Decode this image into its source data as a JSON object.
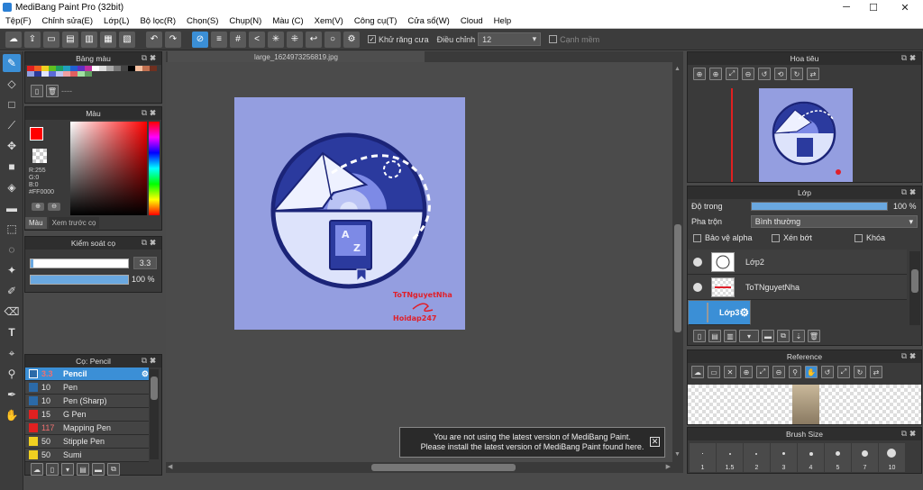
{
  "window": {
    "title": "MediBang Paint Pro (32bit)",
    "minimize": "─",
    "maximize": "☐",
    "close": "✕"
  },
  "menu": [
    "Tệp(F)",
    "Chỉnh sửa(E)",
    "Lớp(L)",
    "Bộ lọc(R)",
    "Chọn(S)",
    "Chụp(N)",
    "Màu (C)",
    "Xem(V)",
    "Công cụ(T)",
    "Cửa sổ(W)",
    "Cloud",
    "Help"
  ],
  "toolbar": {
    "antialias_label": "Khử răng cưa",
    "correction_label": "Điều chỉnh",
    "correction_value": "12",
    "snap_label": "Cạnh mềm"
  },
  "document": {
    "tab_name": "large_1624973256819.jpg"
  },
  "canvas": {
    "watermark_name": "ToTNguyetNha",
    "watermark_site": "Hoidap247"
  },
  "palette": {
    "title": "Bảng màu",
    "more": "----"
  },
  "color": {
    "title": "Màu",
    "readout": [
      "R:255",
      "G:0",
      "B:0",
      "#FF0000"
    ],
    "tab_color": "Màu",
    "tab_preview": "Xem trước cọ",
    "primary": "#ff0000"
  },
  "brush_control": {
    "title": "Kiểm soát cọ",
    "size": "3.3",
    "opacity": "100 %"
  },
  "brushes": {
    "title": "Cọ: Pencil",
    "items": [
      {
        "size": "3.3",
        "name": "Pencil",
        "color": "#2b6aa8"
      },
      {
        "size": "10",
        "name": "Pen",
        "color": "#2b6aa8"
      },
      {
        "size": "10",
        "name": "Pen (Sharp)",
        "color": "#2b6aa8"
      },
      {
        "size": "15",
        "name": "G Pen",
        "color": "#e02020"
      },
      {
        "size": "117",
        "name": "Mapping Pen",
        "color": "#e02020"
      },
      {
        "size": "50",
        "name": "Stipple Pen",
        "color": "#f0d020"
      },
      {
        "size": "50",
        "name": "Sumi",
        "color": "#f0d020"
      }
    ]
  },
  "navigator": {
    "title": "Hoa tiêu"
  },
  "layers": {
    "title": "Lớp",
    "opacity_label": "Độ trong",
    "opacity_value": "100 %",
    "opacity": 1.0,
    "blend_label": "Pha trộn",
    "blend_value": "Bình thường",
    "protect_alpha": "Bảo vệ alpha",
    "clipping": "Xén bớt",
    "lock": "Khóa",
    "items": [
      {
        "name": "Lớp2",
        "selected": false
      },
      {
        "name": "ToTNguyetNha",
        "selected": false
      },
      {
        "name": "Lớp3",
        "selected": true
      }
    ]
  },
  "reference": {
    "title": "Reference"
  },
  "brush_size": {
    "title": "Brush Size",
    "sizes": [
      "1",
      "1.5",
      "2",
      "3",
      "4",
      "5",
      "7",
      "10"
    ]
  },
  "notice": {
    "line1": "You are not using the latest version of MediBang Paint.",
    "line2": "Please install the latest version of MediBang Paint found here."
  }
}
